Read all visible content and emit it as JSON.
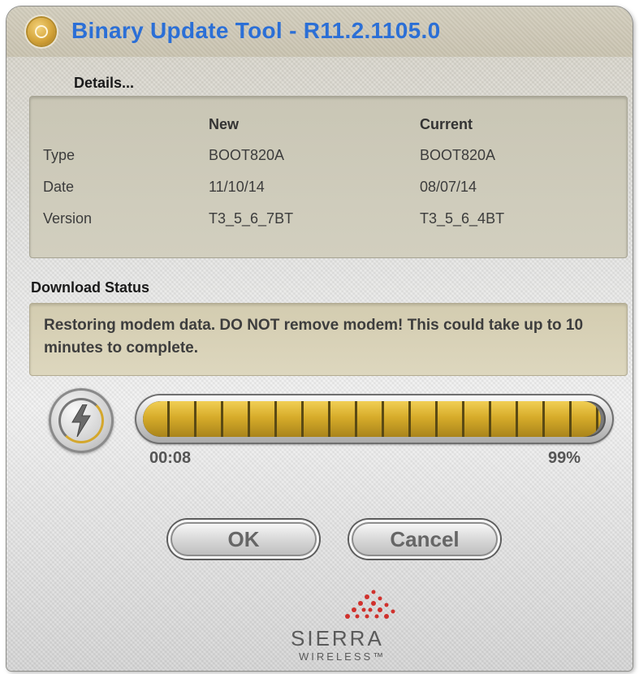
{
  "window": {
    "title": "Binary Update Tool - R11.2.1105.0",
    "accent_color": "#2b6fd6"
  },
  "details": {
    "label": "Details...",
    "columns": [
      "",
      "New",
      "Current"
    ],
    "rows": [
      {
        "label": "Type",
        "new": "BOOT820A",
        "current": "BOOT820A"
      },
      {
        "label": "Date",
        "new": "11/10/14",
        "current": "08/07/14"
      },
      {
        "label": "Version",
        "new": "T3_5_6_7BT",
        "current": "T3_5_6_4BT"
      }
    ]
  },
  "download_status": {
    "label": "Download Status",
    "message": "Restoring modem data.  DO NOT remove modem!  This could take up to 10 minutes to complete."
  },
  "progress": {
    "elapsed": "00:08",
    "percent_label": "99%",
    "fraction": 0.99,
    "fill_color": "#d7ac2a"
  },
  "buttons": {
    "ok": "OK",
    "cancel": "Cancel"
  },
  "logo": {
    "name": "SIERRA",
    "sub": "WIRELESS™",
    "color": "#d0312d"
  }
}
